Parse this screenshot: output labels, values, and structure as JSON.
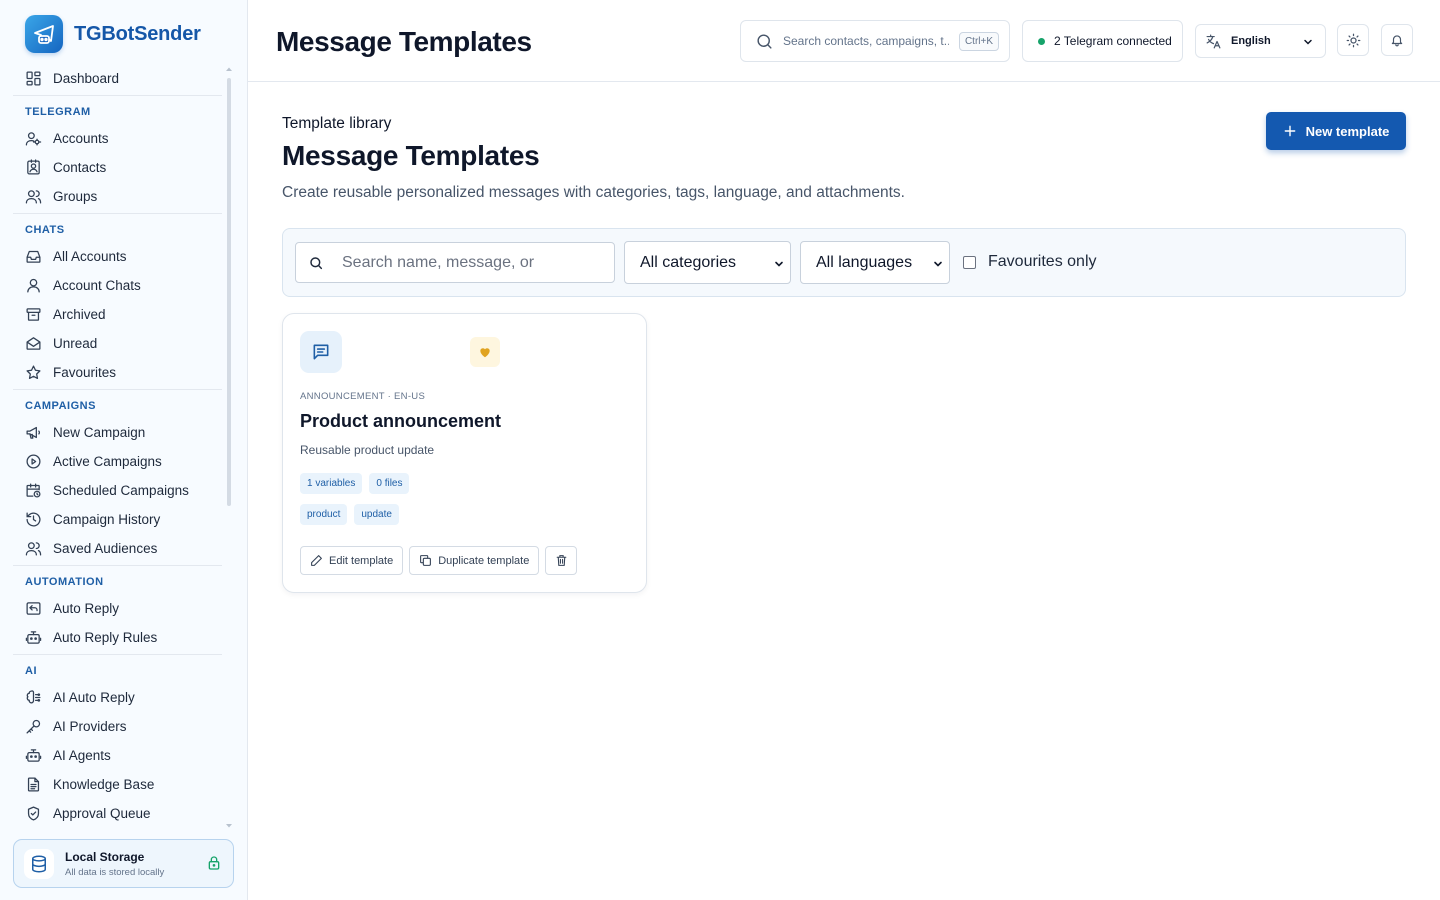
{
  "app": {
    "name": "TGBotSender"
  },
  "sidebar": {
    "dashboard": "Dashboard",
    "sections": {
      "telegram": "TELEGRAM",
      "chats": "CHATS",
      "campaigns": "CAMPAIGNS",
      "automation": "AUTOMATION",
      "ai": "AI"
    },
    "telegram": [
      "Accounts",
      "Contacts",
      "Groups"
    ],
    "chats": [
      "All Accounts",
      "Account Chats",
      "Archived",
      "Unread",
      "Favourites"
    ],
    "campaigns": [
      "New Campaign",
      "Active Campaigns",
      "Scheduled Campaigns",
      "Campaign History",
      "Saved Audiences"
    ],
    "automation": [
      "Auto Reply",
      "Auto Reply Rules"
    ],
    "ai": [
      "AI Auto Reply",
      "AI Providers",
      "AI Agents",
      "Knowledge Base",
      "Approval Queue"
    ],
    "storage": {
      "title": "Local Storage",
      "subtitle": "All data is stored locally"
    }
  },
  "header": {
    "title": "Message Templates",
    "search_placeholder": "Search contacts, campaigns, t...",
    "shortcut": "Ctrl+K",
    "telegram_status": "2 Telegram connected",
    "language": "English"
  },
  "page": {
    "eyebrow": "Template library",
    "title": "Message Templates",
    "description": "Create reusable personalized messages with categories, tags, language, and attachments.",
    "new_button": "New template"
  },
  "filters": {
    "search_placeholder": "Search name, message, or",
    "category": "All categories",
    "language": "All languages",
    "favourites_label": "Favourites only",
    "favourites_checked": false
  },
  "templates": [
    {
      "meta": "ANNOUNCEMENT · EN-US",
      "name": "Product announcement",
      "description": "Reusable product update",
      "variables": "1 variables",
      "files": "0 files",
      "tags": [
        "product",
        "update"
      ],
      "favourite": true,
      "edit_label": "Edit template",
      "duplicate_label": "Duplicate template"
    }
  ],
  "colors": {
    "accent": "#1459b0",
    "brand_text": "#1557a8",
    "section_label": "#1f5fa6",
    "status_ok": "#16a36a",
    "favourite": "#e0a320"
  },
  "icons": {
    "dashboard": "grid-icon",
    "accounts": "user-key-icon",
    "contacts": "contact-card-icon",
    "groups": "users-icon",
    "search": "search-icon",
    "language": "translate-icon",
    "theme": "sun-icon",
    "notifications": "bell-icon",
    "template": "message-square-icon",
    "favourite": "heart-icon",
    "edit": "pencil-icon",
    "duplicate": "copy-icon",
    "delete": "trash-icon",
    "storage": "database-icon",
    "lock": "lock-icon"
  }
}
